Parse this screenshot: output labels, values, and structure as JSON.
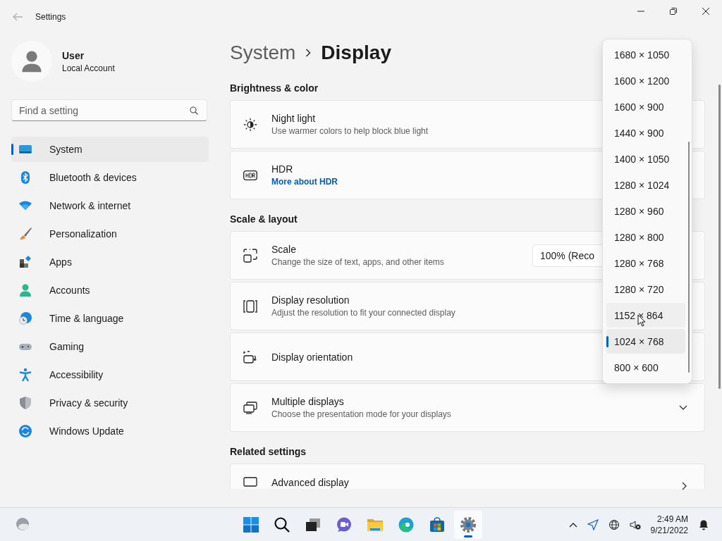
{
  "window": {
    "title": "Settings"
  },
  "account": {
    "name": "User",
    "type": "Local Account"
  },
  "search": {
    "placeholder": "Find a setting"
  },
  "nav": [
    {
      "label": "System",
      "selected": true
    },
    {
      "label": "Bluetooth & devices",
      "selected": false
    },
    {
      "label": "Network & internet",
      "selected": false
    },
    {
      "label": "Personalization",
      "selected": false
    },
    {
      "label": "Apps",
      "selected": false
    },
    {
      "label": "Accounts",
      "selected": false
    },
    {
      "label": "Time & language",
      "selected": false
    },
    {
      "label": "Gaming",
      "selected": false
    },
    {
      "label": "Accessibility",
      "selected": false
    },
    {
      "label": "Privacy & security",
      "selected": false
    },
    {
      "label": "Windows Update",
      "selected": false
    }
  ],
  "breadcrumb": {
    "parent": "System",
    "current": "Display"
  },
  "sections": [
    {
      "title": "Brightness & color",
      "cards": [
        {
          "kind": "plain",
          "title": "Night light",
          "description": "Use warmer colors to help block blue light"
        },
        {
          "kind": "link",
          "title": "HDR",
          "link": "More about HDR"
        }
      ]
    },
    {
      "title": "Scale & layout",
      "cards": [
        {
          "kind": "combo",
          "title": "Scale",
          "description": "Change the size of text, apps, and other items",
          "value": "100% (Reco"
        },
        {
          "kind": "plain",
          "title": "Display resolution",
          "description": "Adjust the resolution to fit your connected display"
        },
        {
          "kind": "plain",
          "title": "Display orientation"
        },
        {
          "kind": "expander",
          "title": "Multiple displays",
          "description": "Choose the presentation mode for your displays"
        }
      ]
    },
    {
      "title": "Related settings",
      "cards": [
        {
          "kind": "nav",
          "title": "Advanced display"
        }
      ]
    }
  ],
  "resolution_menu": {
    "options": [
      {
        "label": "1680 × 1050",
        "selected": false,
        "hovered": false
      },
      {
        "label": "1600 × 1200",
        "selected": false,
        "hovered": false
      },
      {
        "label": "1600 × 900",
        "selected": false,
        "hovered": false
      },
      {
        "label": "1440 × 900",
        "selected": false,
        "hovered": false
      },
      {
        "label": "1400 × 1050",
        "selected": false,
        "hovered": false
      },
      {
        "label": "1280 × 1024",
        "selected": false,
        "hovered": false
      },
      {
        "label": "1280 × 960",
        "selected": false,
        "hovered": false
      },
      {
        "label": "1280 × 800",
        "selected": false,
        "hovered": false
      },
      {
        "label": "1280 × 768",
        "selected": false,
        "hovered": false
      },
      {
        "label": "1280 × 720",
        "selected": false,
        "hovered": false
      },
      {
        "label": "1152 × 864",
        "selected": false,
        "hovered": true
      },
      {
        "label": "1024 × 768",
        "selected": true,
        "hovered": false
      },
      {
        "label": "800 × 600",
        "selected": false,
        "hovered": false
      }
    ]
  },
  "taskbar": {
    "apps": [
      {
        "active": false
      },
      {
        "active": false
      },
      {
        "active": false
      },
      {
        "active": false
      },
      {
        "active": false
      },
      {
        "active": false
      },
      {
        "active": false
      },
      {
        "active": true
      }
    ],
    "clock": {
      "time": "2:49 AM",
      "date": "9/21/2022"
    }
  }
}
